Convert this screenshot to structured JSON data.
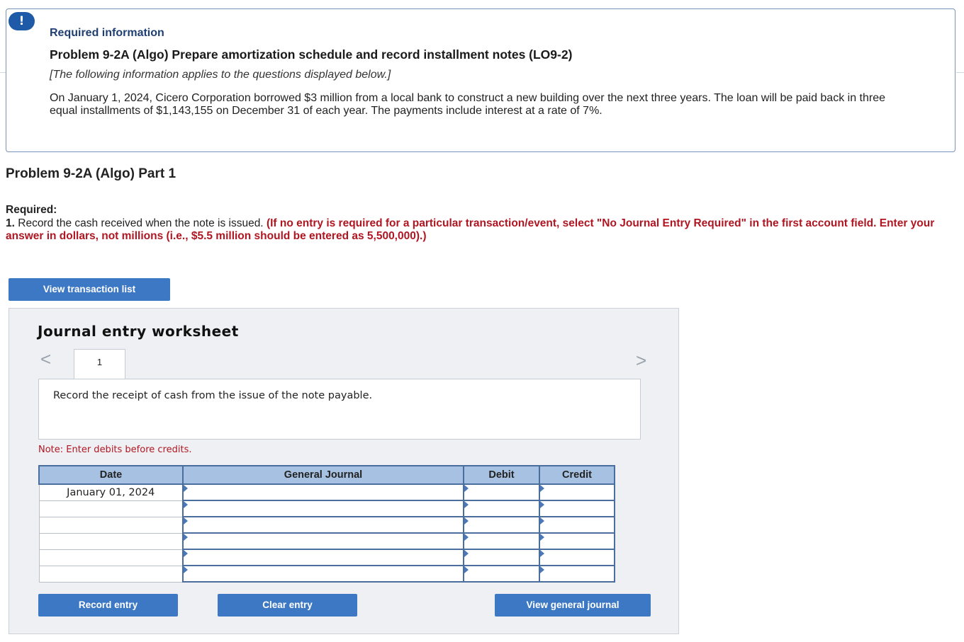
{
  "info": {
    "alert_icon": "!",
    "required_information": "Required information",
    "problem_title": "Problem 9-2A (Algo) Prepare amortization schedule and record installment notes (LO9-2)",
    "applies_note": "[The following information applies to the questions displayed below.]",
    "scenario": "On January 1, 2024, Cicero Corporation borrowed $3 million from a local bank to construct a new building over the next three years. The loan will be paid back in three equal installments of $1,143,155 on December 31 of each year. The payments include interest at a rate of 7%."
  },
  "part_title": "Problem 9-2A (Algo) Part 1",
  "required": {
    "label": "Required:",
    "item_number": "1.",
    "item_text": "Record the cash received when the note is issued.",
    "instructions": "(If no entry is required for a particular transaction/event, select \"No Journal Entry Required\" in the first account field. Enter your answer in dollars, not millions (i.e., $5.5 million should be entered as 5,500,000).)"
  },
  "buttons": {
    "view_transaction_list": "View transaction list",
    "record_entry": "Record entry",
    "clear_entry": "Clear entry",
    "view_general_journal": "View general journal"
  },
  "worksheet": {
    "title": "Journal entry worksheet",
    "nav_prev": "<",
    "nav_next": ">",
    "tab_label": "1",
    "description": "Record the receipt of cash from the issue of the note payable.",
    "note": "Note: Enter debits before credits.",
    "columns": [
      "Date",
      "General Journal",
      "Debit",
      "Credit"
    ],
    "rows": [
      {
        "date": "January 01, 2024",
        "account": "",
        "debit": "",
        "credit": ""
      },
      {
        "date": "",
        "account": "",
        "debit": "",
        "credit": ""
      },
      {
        "date": "",
        "account": "",
        "debit": "",
        "credit": ""
      },
      {
        "date": "",
        "account": "",
        "debit": "",
        "credit": ""
      },
      {
        "date": "",
        "account": "",
        "debit": "",
        "credit": ""
      },
      {
        "date": "",
        "account": "",
        "debit": "",
        "credit": ""
      }
    ]
  },
  "colors": {
    "accent_blue": "#3d78c4",
    "header_blue": "#a7c1e3",
    "instruction_red": "#b01622"
  }
}
